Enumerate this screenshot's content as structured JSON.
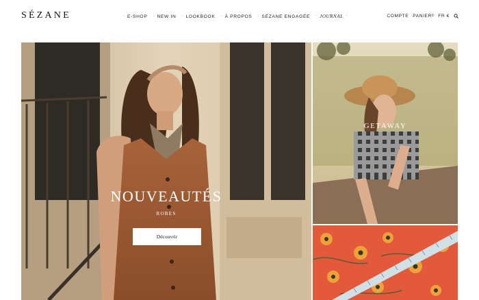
{
  "brand": {
    "logo_text": "SÉZANE"
  },
  "nav": {
    "items": [
      {
        "label": "E-SHOP"
      },
      {
        "label": "NEW IN"
      },
      {
        "label": "LOOKBOOK"
      },
      {
        "label": "À PROPOS"
      },
      {
        "label": "SÉZANE ENGAGÉE"
      },
      {
        "label": "JOURNAL"
      }
    ]
  },
  "utils": {
    "account_label": "COMPTE",
    "cart_label": "PANIER",
    "cart_count": "0",
    "language_label": "FR €",
    "search_icon": "search-icon"
  },
  "hero": {
    "title": "NOUVEAUTÉS",
    "subtitle": "ROBES",
    "button_label": "Découvrir"
  },
  "tiles": {
    "getaway_title": "GETAWAY"
  },
  "colors": {
    "text": "#1a1a1a",
    "hero_dress": "#9a5a32",
    "fabric_orange": "#e35a3a",
    "button_bg": "#ffffff"
  }
}
